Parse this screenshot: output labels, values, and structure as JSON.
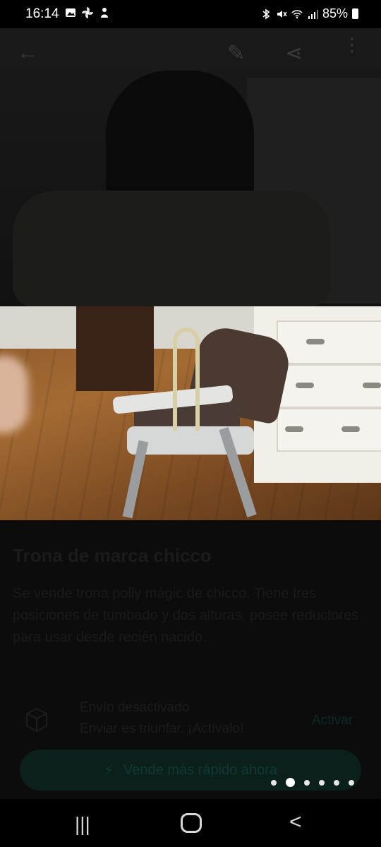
{
  "status_bar": {
    "time": "16:14",
    "battery": "85%",
    "left_icons": [
      "image-icon",
      "pinwheel-icon",
      "person-icon"
    ],
    "right_icons": [
      "bluetooth-icon",
      "mute-icon",
      "wifi-icon",
      "signal-icon",
      "battery-icon"
    ]
  },
  "top_actions": {
    "back_icon": "←",
    "edit_icon": "✎",
    "share_icon": "⋖",
    "more_icon": "⋮"
  },
  "product": {
    "title": "Trona de marca chicco",
    "description": "Se vende trona polly mágic de chicco. Tiene tres posiciones de tumbado y dos alturas, posee reductores para usar desde recién nacido."
  },
  "shipping": {
    "title": "Envío desactivado",
    "subtitle": "Enviar es triunfar. ¡Actívalo!",
    "action": "Activar"
  },
  "cta": {
    "label": "Vende más rápido ahora"
  },
  "pagination": {
    "total": 6,
    "current": 2
  },
  "nav": {
    "recent": "|||",
    "home": "",
    "back": "<"
  },
  "colors": {
    "overlay": "#000000",
    "dot_active": "#ffffff",
    "dot_inactive": "#e6e6e6"
  }
}
